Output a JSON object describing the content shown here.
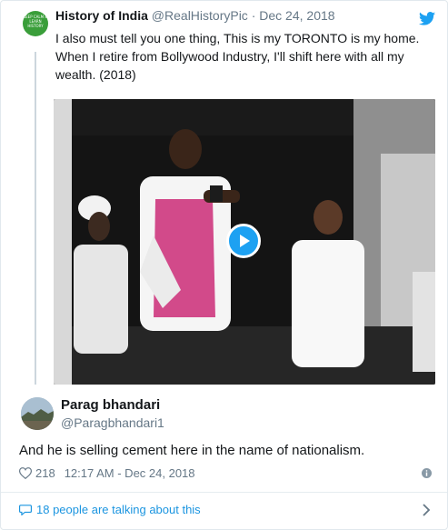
{
  "tweet": {
    "author_name": "History of India",
    "author_handle": "@RealHistoryPic",
    "separator": "·",
    "date": "Dec 24, 2018",
    "avatar_text": "KEEP CALM & LEARN HISTORY",
    "text": "I also must tell you one thing, This is my TORONTO is my home.\nWhen I retire from Bollywood Industry, I'll shift here with all my\nwealth. (2018)"
  },
  "reply": {
    "author_name": "Parag bhandari",
    "author_handle": "@Paragbhandari1",
    "text": "And he is selling cement here in the name of nationalism.",
    "like_count": "218",
    "timestamp": "12:17 AM - Dec 24, 2018"
  },
  "footer": {
    "talking_text": "18 people are talking about this"
  },
  "colors": {
    "accent": "#1da1f2",
    "link": "#1b95e0",
    "muted": "#657786"
  },
  "icons": [
    "twitter-bird-icon",
    "play-icon",
    "heart-icon",
    "info-icon",
    "comment-bubble-icon",
    "chevron-right-icon"
  ]
}
